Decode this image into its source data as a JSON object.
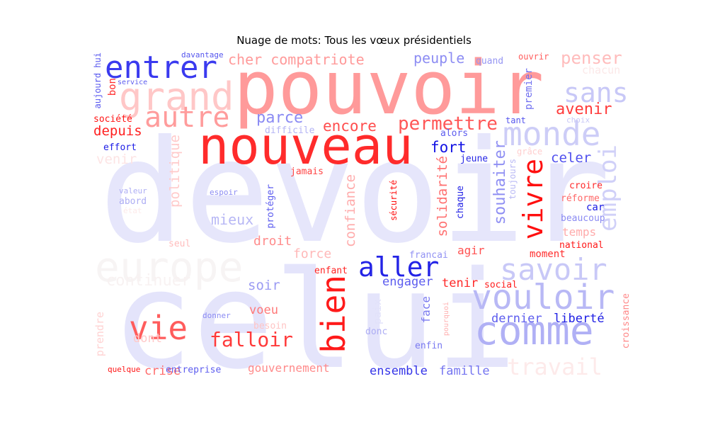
{
  "title": "Nuage de mots: Tous les vœux présidentiels",
  "words": [
    {
      "text": "devoir",
      "color": "#e6e6fb"
    },
    {
      "text": "celui",
      "color": "#e4e4fb"
    },
    {
      "text": "europe",
      "color": "#f7f4f4"
    },
    {
      "text": "pouvoir",
      "color": "#ff9a9a"
    },
    {
      "text": "nouveau",
      "color": "#ff2b2b"
    },
    {
      "text": "grand",
      "color": "#ffc7c7"
    },
    {
      "text": "entrer",
      "color": "#3a3aef"
    },
    {
      "text": "autre",
      "color": "#ff9c9c"
    },
    {
      "text": "monde",
      "color": "#cdcdf7"
    },
    {
      "text": "sans",
      "color": "#c8c8f7"
    },
    {
      "text": "penser",
      "color": "#ffbcbc"
    },
    {
      "text": "chacun",
      "color": "#fbe8e8"
    },
    {
      "text": "cher compatriote",
      "color": "#ff9a9a"
    },
    {
      "text": "peuple",
      "color": "#8d8df3"
    },
    {
      "text": "parce",
      "color": "#8b8bf3"
    },
    {
      "text": "permettre",
      "color": "#ff5757"
    },
    {
      "text": "encore",
      "color": "#ff4d4d"
    },
    {
      "text": "avenir",
      "color": "#ff3b3b"
    },
    {
      "text": "depuis",
      "color": "#ff2020"
    },
    {
      "text": "fort",
      "color": "#1212e4"
    },
    {
      "text": "emploi",
      "color": "#d0d0f8"
    },
    {
      "text": "vivre",
      "color": "#ff0f0f"
    },
    {
      "text": "souhaiter",
      "color": "#8f8ff3"
    },
    {
      "text": "solidarité",
      "color": "#ff7070"
    },
    {
      "text": "confiance",
      "color": "#ffacac"
    },
    {
      "text": "celer",
      "color": "#5050ee"
    },
    {
      "text": "sécurité",
      "color": "#ff1010"
    },
    {
      "text": "politique",
      "color": "#ffcaca"
    },
    {
      "text": "aller",
      "color": "#2424e6"
    },
    {
      "text": "savoir",
      "color": "#c8c8f7"
    },
    {
      "text": "bien",
      "color": "#ff1a1a"
    },
    {
      "text": "vouloir",
      "color": "#b8b8f5"
    },
    {
      "text": "comme",
      "color": "#b0b0f5"
    },
    {
      "text": "vie",
      "color": "#ff5c5c"
    },
    {
      "text": "falloir",
      "color": "#ff3a3a"
    },
    {
      "text": "travail",
      "color": "#fdeaea"
    },
    {
      "text": "mieux",
      "color": "#b8b8f5"
    },
    {
      "text": "droit",
      "color": "#ff8c8c"
    },
    {
      "text": "force",
      "color": "#ffb8b8"
    },
    {
      "text": "agir",
      "color": "#ff5252"
    },
    {
      "text": "moment",
      "color": "#ff3030"
    },
    {
      "text": "temps",
      "color": "#ffabab"
    },
    {
      "text": "engager",
      "color": "#5c5cef"
    },
    {
      "text": "tenir",
      "color": "#ff2929"
    },
    {
      "text": "social",
      "color": "#ff1f1f"
    },
    {
      "text": "soir",
      "color": "#9b9bf3"
    },
    {
      "text": "voeu",
      "color": "#ff7878"
    },
    {
      "text": "dernier",
      "color": "#5c5cee"
    },
    {
      "text": "liberté",
      "color": "#1c1ce4"
    },
    {
      "text": "ensemble",
      "color": "#3434e8"
    },
    {
      "text": "famille",
      "color": "#7474f0"
    },
    {
      "text": "gouvernement",
      "color": "#ff8b8b"
    },
    {
      "text": "crise",
      "color": "#ff6c6c"
    },
    {
      "text": "entreprise",
      "color": "#5d5def"
    },
    {
      "text": "dont",
      "color": "#ffc8c8"
    },
    {
      "text": "enfin",
      "color": "#7a7af0"
    },
    {
      "text": "face",
      "color": "#7a7af0"
    },
    {
      "text": "paix",
      "color": "#e2e2fa"
    },
    {
      "text": "donc",
      "color": "#adadf4"
    },
    {
      "text": "croissance",
      "color": "#ff8888"
    },
    {
      "text": "prendre",
      "color": "#ffd3d3"
    },
    {
      "text": "quelque",
      "color": "#ff1515"
    },
    {
      "text": "besoin",
      "color": "#ffc4c4"
    },
    {
      "text": "donner",
      "color": "#8b8bf3"
    },
    {
      "text": "pourquoi",
      "color": "#ffb0b0"
    },
    {
      "text": "enfant",
      "color": "#ff2525"
    },
    {
      "text": "francai",
      "color": "#9393f3"
    },
    {
      "text": "national",
      "color": "#ff1818"
    },
    {
      "text": "beaucoup",
      "color": "#8a8af2"
    },
    {
      "text": "car",
      "color": "#1616e4"
    },
    {
      "text": "réforme",
      "color": "#ff6868"
    },
    {
      "text": "croire",
      "color": "#ff2c2c"
    },
    {
      "text": "toujours",
      "color": "#b9b9f5"
    },
    {
      "text": "grâce",
      "color": "#ffcfcf"
    },
    {
      "text": "choix",
      "color": "#c9c9f6"
    },
    {
      "text": "tant",
      "color": "#5555ee"
    },
    {
      "text": "jeune",
      "color": "#2727e6"
    },
    {
      "text": "chaque",
      "color": "#2222e6"
    },
    {
      "text": "protéger",
      "color": "#5d5def"
    },
    {
      "text": "jamais",
      "color": "#ff4545"
    },
    {
      "text": "espoir",
      "color": "#8c8cf3"
    },
    {
      "text": "seul",
      "color": "#ffbcbc"
    },
    {
      "text": "valeur",
      "color": "#adadf4"
    },
    {
      "text": "abord",
      "color": "#adadf4"
    },
    {
      "text": "état",
      "color": "#fdeaea"
    },
    {
      "text": "venir",
      "color": "#fde4e4"
    },
    {
      "text": "effort",
      "color": "#2020e6"
    },
    {
      "text": "société",
      "color": "#ff1515"
    },
    {
      "text": "bon",
      "color": "#ff2a2a"
    },
    {
      "text": "aujourd hui",
      "color": "#5858ef"
    },
    {
      "text": "service",
      "color": "#5c5cef"
    },
    {
      "text": "davantage",
      "color": "#5555ee"
    },
    {
      "text": "difficile",
      "color": "#b4b4f5"
    },
    {
      "text": "alors",
      "color": "#5c5cef"
    },
    {
      "text": "quand",
      "color": "#9696f3"
    },
    {
      "text": "ouvrir",
      "color": "#ff5c5c"
    },
    {
      "text": "premier",
      "color": "#7070f0"
    },
    {
      "text": "continuer",
      "color": "#f8f2f2"
    }
  ]
}
